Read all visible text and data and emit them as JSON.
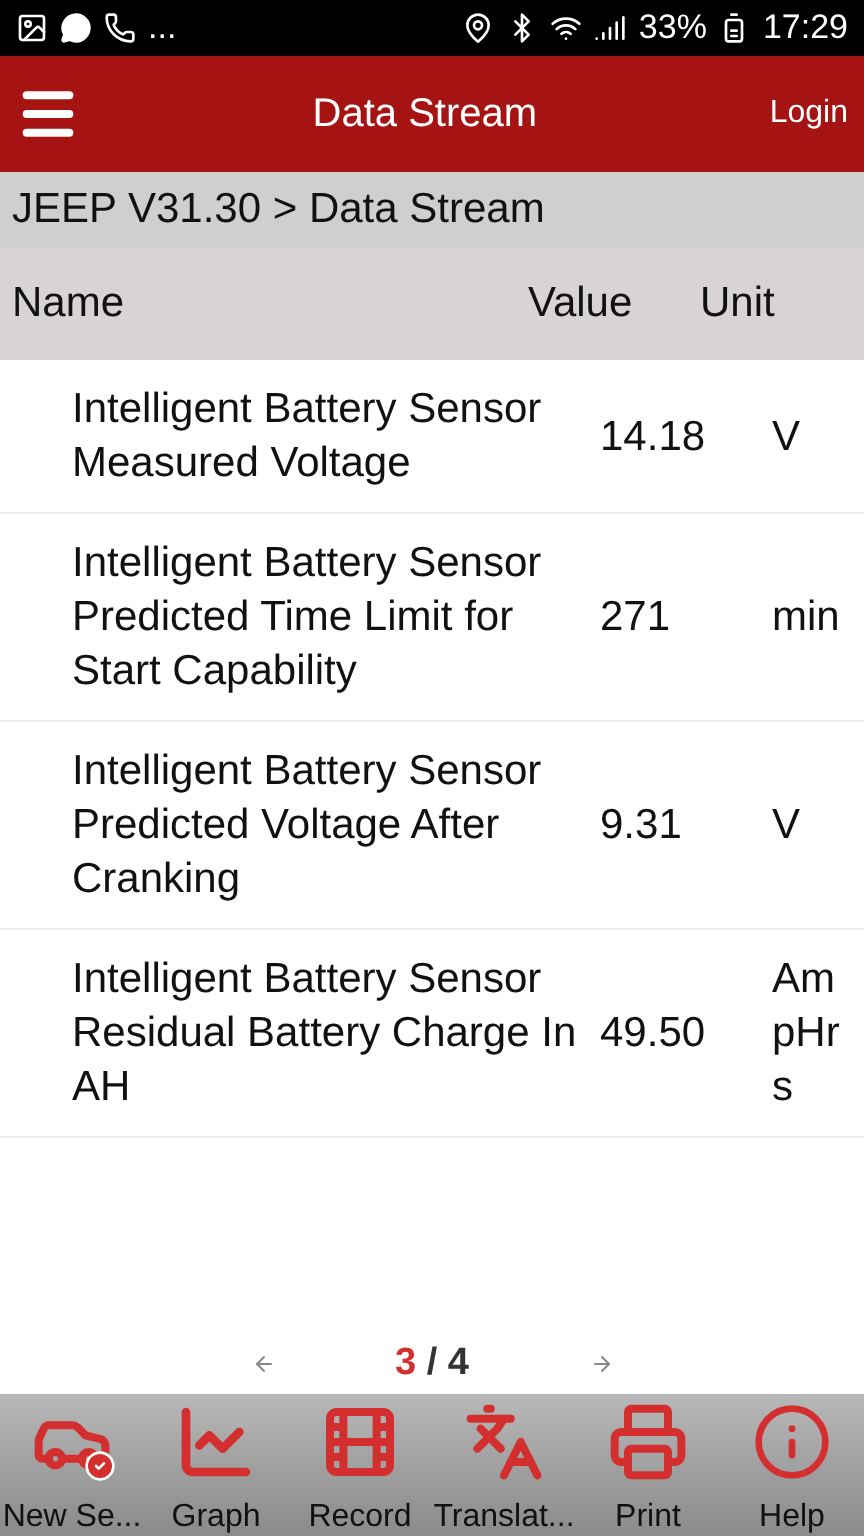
{
  "status_bar": {
    "more": "...",
    "battery": "33%",
    "time": "17:29"
  },
  "header": {
    "title": "Data Stream",
    "login": "Login"
  },
  "breadcrumb": "JEEP V31.30 > Data Stream",
  "table": {
    "columns": [
      "Name",
      "Value",
      "Unit"
    ],
    "rows": [
      {
        "name": "Intelligent Battery Sensor Measured Voltage",
        "value": "14.18",
        "unit": "V"
      },
      {
        "name": "Intelligent Battery Sensor Predicted Time Limit for Start Capability",
        "value": "271",
        "unit": "min"
      },
      {
        "name": "Intelligent Battery Sensor Predicted Voltage After Cranking",
        "value": "9.31",
        "unit": "V"
      },
      {
        "name": "Intelligent Battery Sensor Residual Battery Charge In AH",
        "value": "49.50",
        "unit": "AmpHrs"
      }
    ]
  },
  "pager": {
    "current": "3",
    "separator": "/",
    "total": "4"
  },
  "toolbar": [
    {
      "kind": "car",
      "label": "New Se..."
    },
    {
      "kind": "graph",
      "label": "Graph"
    },
    {
      "kind": "record",
      "label": "Record"
    },
    {
      "kind": "translate",
      "label": "Translat..."
    },
    {
      "kind": "print",
      "label": "Print"
    },
    {
      "kind": "help",
      "label": "Help"
    }
  ]
}
